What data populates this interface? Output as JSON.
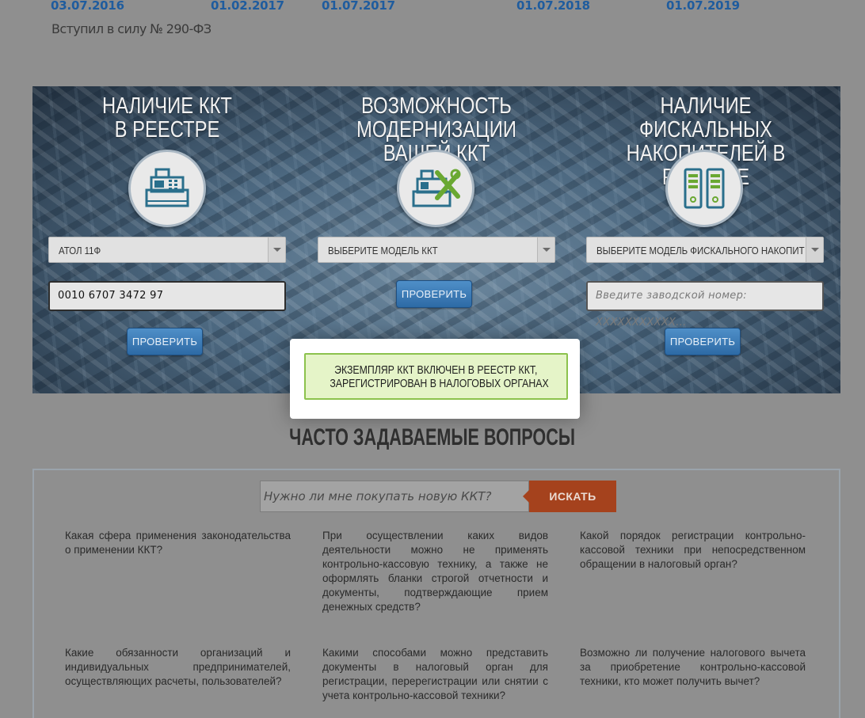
{
  "timeline": {
    "dates": [
      "03.07.2016",
      "01.02.2017",
      "01.07.2017",
      "01.07.2018",
      "01.07.2019"
    ],
    "caption": "Вступил в силу № 290-ФЗ"
  },
  "tools": {
    "registry": {
      "title_line1": "НАЛИЧИЕ ККТ",
      "title_line2": "В РЕЕСТРЕ",
      "icon": "cash-register-icon",
      "select_value": "АТОЛ 11Ф",
      "serial_value": "0010 6707 3472 97",
      "button": "ПРОВЕРИТЬ"
    },
    "modernization": {
      "title_line1": "ВОЗМОЖНОСТЬ",
      "title_line2": "МОДЕРНИЗАЦИИ ВАШЕЙ ККТ",
      "icon": "cash-register-tools-icon",
      "select_value": "ВЫБЕРИТЕ МОДЕЛЬ ККТ",
      "button": "ПРОВЕРИТЬ"
    },
    "fiscal": {
      "title_line1": "НАЛИЧИЕ ФИСКАЛЬНЫХ",
      "title_line2": "НАКОПИТЕЛЕЙ В РЕЕСТРЕ",
      "icon": "fiscal-storage-icon",
      "select_value": "ВЫБЕРИТЕ МОДЕЛЬ ФИСКАЛЬНОГО НАКОПИТ",
      "serial_placeholder": "Введите заводской номер: XXXXXXXXXXX...",
      "button": "ПРОВЕРИТЬ"
    }
  },
  "modal": {
    "line1": "ЭКЗЕМПЛЯР ККТ ВКЛЮЧЕН В РЕЕСТР ККТ,",
    "line2": "ЗАРЕГИСТРИРОВАН В НАЛОГОВЫХ ОРГАНАХ"
  },
  "faq": {
    "title": "ЧАСТО ЗАДАВАЕМЫЕ ВОПРОСЫ",
    "search_placeholder": "Нужно ли мне покупать новую ККТ?",
    "search_button": "ИСКАТЬ",
    "questions": [
      "Какая сфера применения законодательства о применении ККТ?",
      "При осуществлении каких видов деятельности можно не применять контрольно-кассовую технику, а также не оформлять бланки строгой отчетности и документы, подтверждающие прием денежных средств?",
      "Какой порядок регистрации контрольно-кассовой техники при непосредственном обращении в налоговый орган?",
      "Какие обязанности организаций и индивидуальных предпринимателей, осуществляющих расчеты, пользователей?",
      "Какими способами можно представить документы в налоговый орган для регистрации, перерегистрации или снятии с учета контрольно-кассовой техники?",
      "Возможно ли получение налогового вычета за приобретение контрольно-кассовой техники, кто может получить вычет?"
    ]
  }
}
